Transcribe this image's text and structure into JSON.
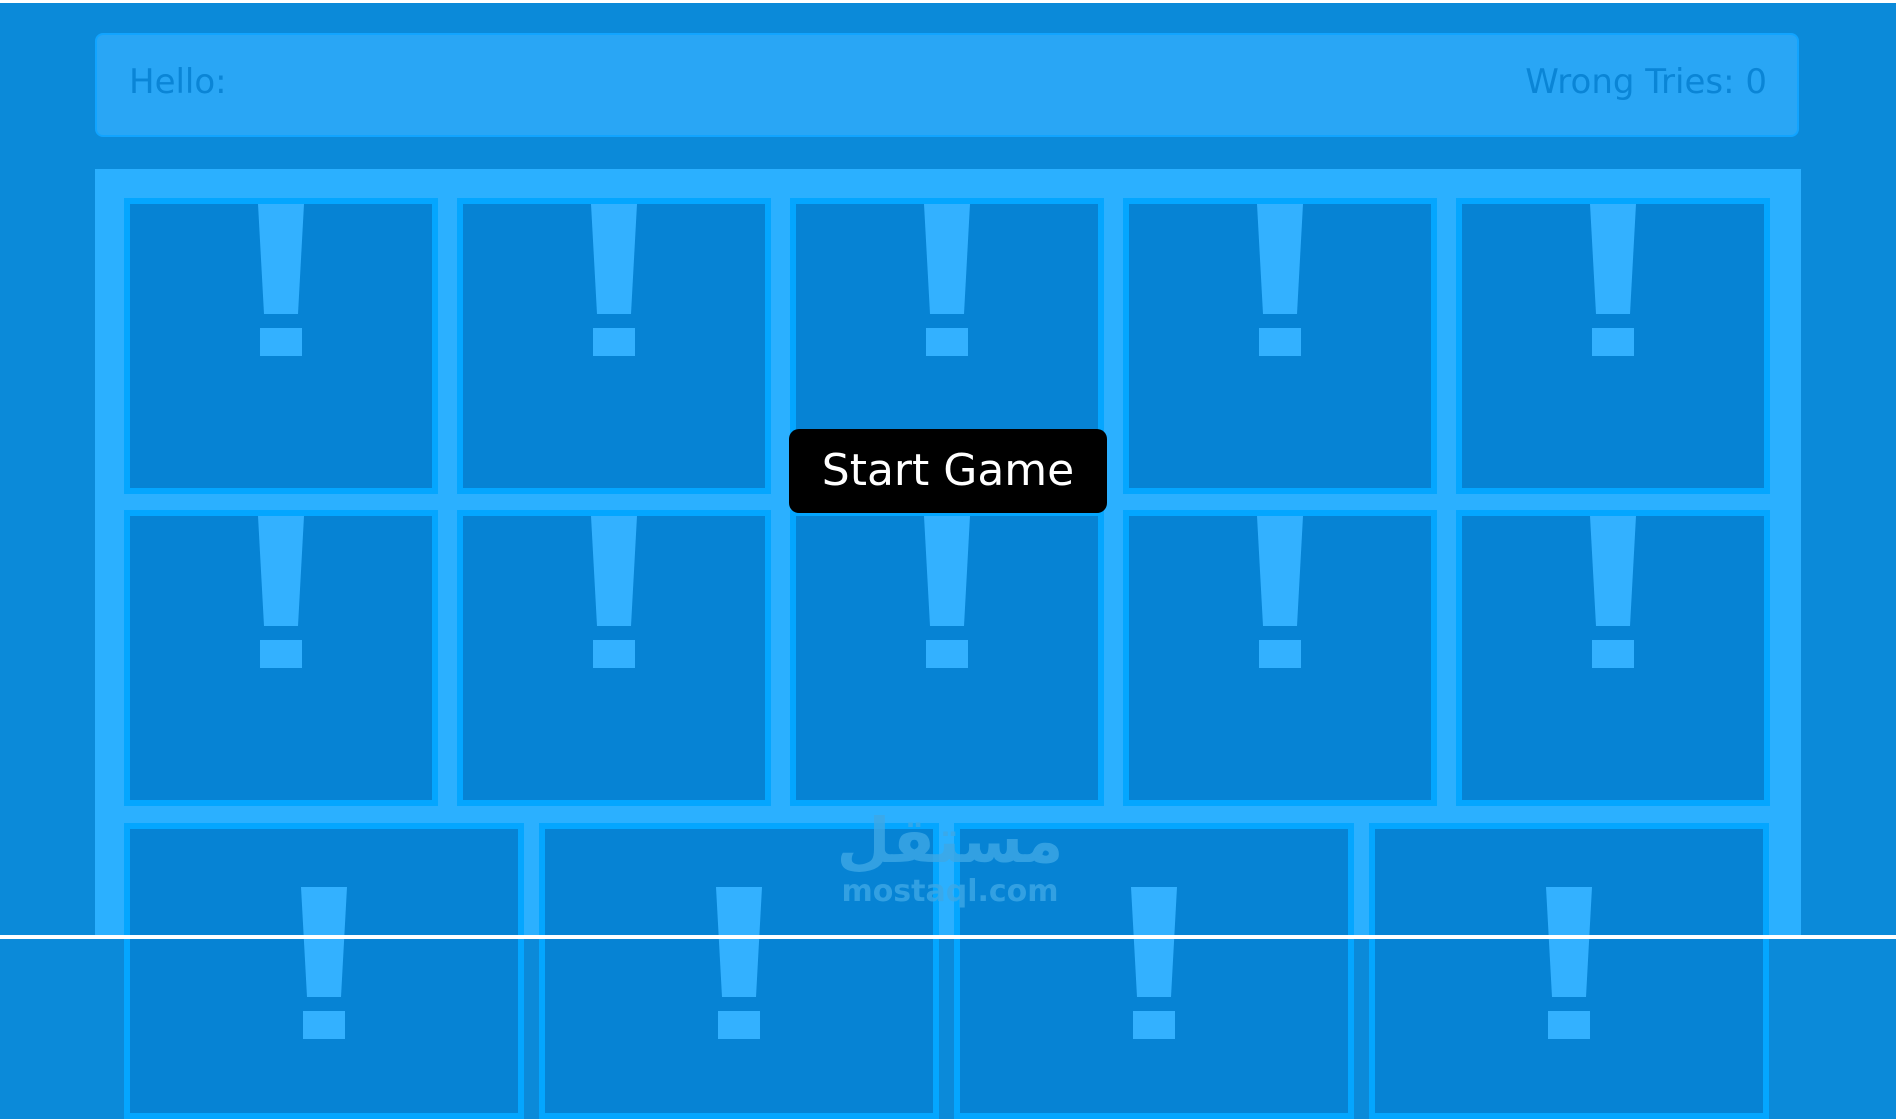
{
  "header": {
    "greeting": "Hello:",
    "wrong_tries_label": "Wrong Tries: 0"
  },
  "board": {
    "card_face": "!",
    "rows": [
      {
        "cards": [
          "!",
          "!",
          "!",
          "!",
          "!"
        ]
      },
      {
        "cards": [
          "!",
          "!",
          "!",
          "!",
          "!"
        ]
      },
      {
        "cards": [
          "!",
          "!",
          "!",
          "!"
        ]
      }
    ]
  },
  "overlay": {
    "start_button_label": "Start Game"
  },
  "watermark": {
    "logo_text": "مستقل",
    "url": "mostaql.com"
  },
  "colors": {
    "page_background": "#0b8ad9",
    "info_bar": "#29a6f5",
    "board_background": "#2bb0ff",
    "card_fill": "#0683d4",
    "card_border": "#04a6ff",
    "card_symbol": "#33b1ff",
    "button_background": "#000000",
    "button_text": "#ffffff"
  }
}
